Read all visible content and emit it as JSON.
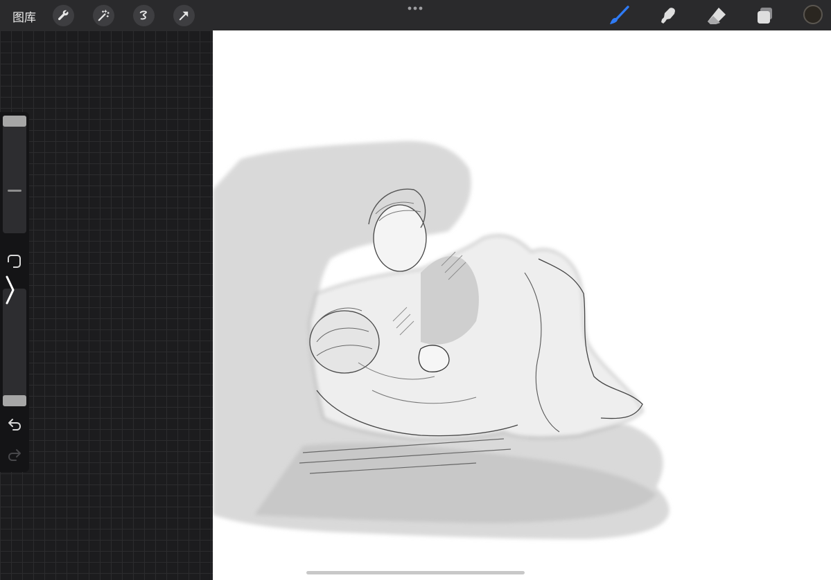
{
  "topbar": {
    "gallery_label": "图库",
    "left_tools": [
      {
        "icon": "wrench-icon",
        "name": "actions"
      },
      {
        "icon": "magic-wand-icon",
        "name": "adjustments"
      },
      {
        "icon": "selection-icon",
        "name": "selection"
      },
      {
        "icon": "transform-arrow-icon",
        "name": "transform"
      }
    ],
    "more_icon": "more-dots-icon",
    "right_tools": [
      {
        "icon": "brush-icon",
        "name": "paint",
        "active": true,
        "color": "#2f7bf5"
      },
      {
        "icon": "smudge-icon",
        "name": "smudge"
      },
      {
        "icon": "eraser-icon",
        "name": "erase"
      },
      {
        "icon": "layers-icon",
        "name": "layers"
      }
    ],
    "current_color": "#2a2620"
  },
  "sidebar": {
    "brush_size_level": 1.0,
    "brush_opacity_level": 0.0,
    "buttons": [
      "modify-button",
      "undo-button",
      "redo-button"
    ]
  },
  "canvas": {
    "artwork": "pencil-sketch-two-figures-grappling"
  },
  "colors": {
    "toolbar": "#2a2a2c",
    "accent": "#2f7bf5",
    "workspace": "#1c1c1e"
  }
}
